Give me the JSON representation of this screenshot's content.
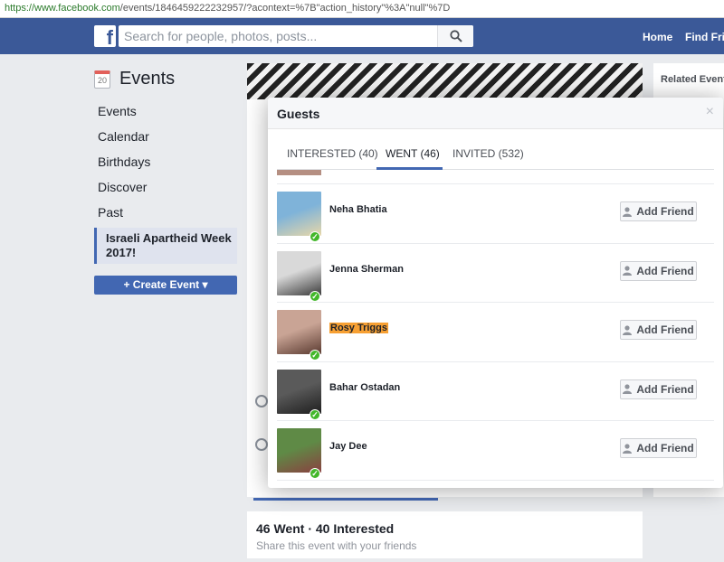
{
  "browser": {
    "url_host": "https://www.facebook.com",
    "url_path": "/events/1846459222232957/?acontext=%7B\"action_history\"%3A\"null\"%7D"
  },
  "topbar": {
    "logo_letter": "f",
    "search_placeholder": "Search for people, photos, posts...",
    "nav_home": "Home",
    "nav_find_friends": "Find Frie"
  },
  "leftnav": {
    "calendar_day": "20",
    "title": "Events",
    "items": [
      "Events",
      "Calendar",
      "Birthdays",
      "Discover",
      "Past"
    ],
    "selected_event": "Israeli Apartheid Week 2017!",
    "create_button": "+ Create Event ▾"
  },
  "related": {
    "title": "Related Events"
  },
  "stats": {
    "title": "46 Went · 40 Interested",
    "subtitle": "Share this event with your friends"
  },
  "modal": {
    "title": "Guests",
    "close": "×",
    "tabs": [
      {
        "label": "INTERESTED (40)",
        "active": false
      },
      {
        "label": "WENT (46)",
        "active": true
      },
      {
        "label": "INVITED (532)",
        "active": false
      }
    ],
    "add_friend_label": "Add Friend",
    "guests": [
      {
        "name": "Neha Bhatia",
        "highlighted": false,
        "avatar_colors": [
          "#7fb3d9",
          "#e8d7a8"
        ]
      },
      {
        "name": "Jenna Sherman",
        "highlighted": false,
        "avatar_colors": [
          "#d9d9d9",
          "#3a3a3a"
        ]
      },
      {
        "name": "Rosy Triggs",
        "highlighted": true,
        "avatar_colors": [
          "#c9a495",
          "#5a3a30"
        ]
      },
      {
        "name": "Bahar Ostadan",
        "highlighted": false,
        "avatar_colors": [
          "#5a5a5a",
          "#1e1e1e"
        ]
      },
      {
        "name": "Jay Dee",
        "highlighted": false,
        "avatar_colors": [
          "#5f8a46",
          "#8a4040"
        ]
      }
    ]
  },
  "colors": {
    "brand_blue": "#3b5998",
    "button_blue": "#4267b2",
    "check_green": "#42b72a",
    "highlight": "#f7a033"
  }
}
